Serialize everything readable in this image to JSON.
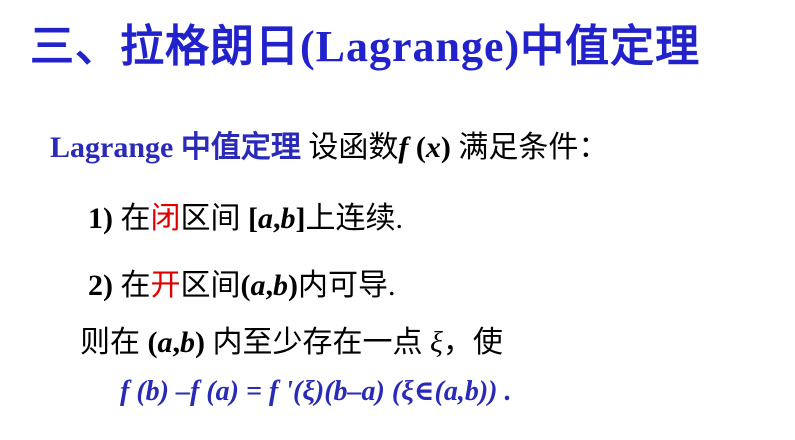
{
  "title": "三、拉格朗日(Lagrange)中值定理",
  "theorem": {
    "name": "Lagrange 中值定理",
    "lead": "设函数",
    "f": "f",
    "fx_open": " (",
    "x": "x",
    "fx_close": ") ",
    "tail": "满足条件："
  },
  "condition1": {
    "num": "1)",
    "pre": " 在",
    "kw": "闭",
    "mid": "区间 ",
    "lb": "[",
    "a": "a",
    "comma": ",",
    "b": "b",
    "rb": "]",
    "post": "上连续."
  },
  "condition2": {
    "num": "2)",
    "pre": " 在",
    "kw": "开",
    "mid": "区间",
    "lp": "(",
    "a": "a",
    "comma": ",",
    "b": "b",
    "rp": ")",
    "post": "内可导."
  },
  "conclusion": {
    "pre": "则在 ",
    "lp": "(",
    "a": "a",
    "comma": ",",
    "b": "b",
    "rp": ")",
    "mid": " 内至少存在一点 ",
    "xi": "ξ",
    "post": "，使"
  },
  "formula": "f (b) –f (a) = f '(ξ)(b–a)   (ξ∈(a,b))  ."
}
